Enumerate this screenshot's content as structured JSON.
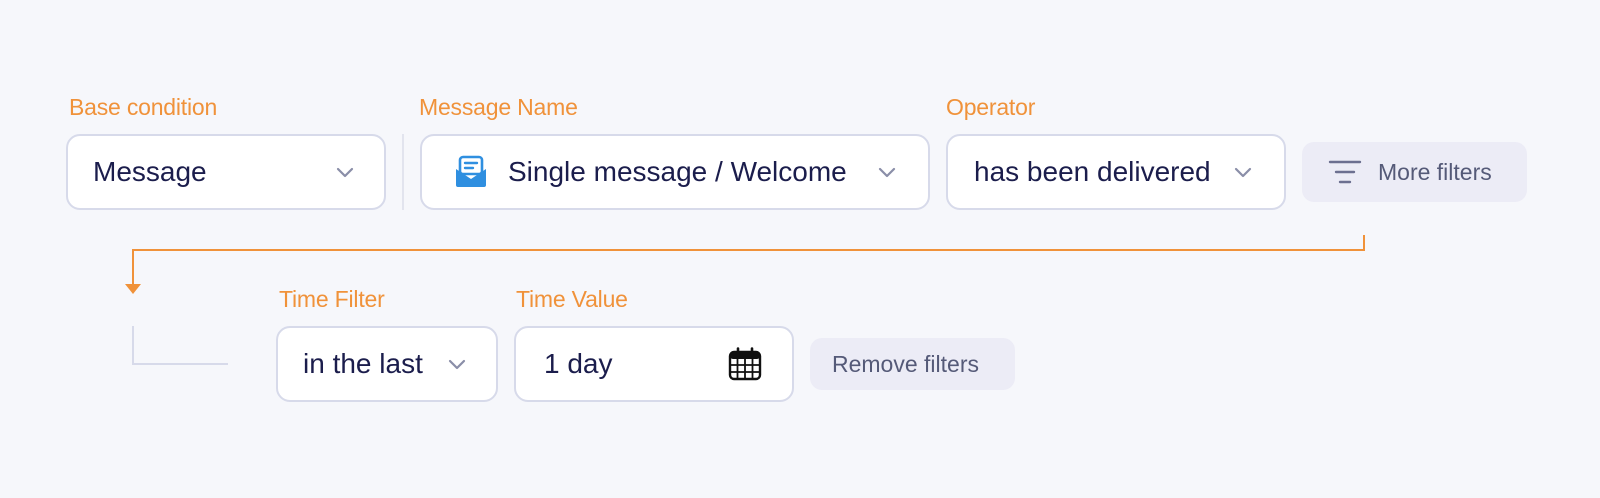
{
  "labels": {
    "base_condition": "Base condition",
    "message_name": "Message Name",
    "operator": "Operator",
    "time_filter": "Time Filter",
    "time_value": "Time Value"
  },
  "base_condition": {
    "value": "Message"
  },
  "message_name": {
    "value": "Single message / Welcome",
    "icon": "message-envelope-icon"
  },
  "operator": {
    "value": "has been delivered"
  },
  "more_filters": {
    "label": "More filters",
    "icon": "filter-lines-icon"
  },
  "time_filter": {
    "value": "in the last"
  },
  "time_value": {
    "value": "1 day",
    "icon": "calendar-icon"
  },
  "remove_filters": {
    "label": "Remove filters"
  },
  "colors": {
    "accent": "#f0923a",
    "background": "#f6f7fb",
    "text": "#1b1d4c",
    "border": "#d7daea",
    "button_bg": "#ececf6",
    "icon_blue": "#2f8fe0"
  }
}
